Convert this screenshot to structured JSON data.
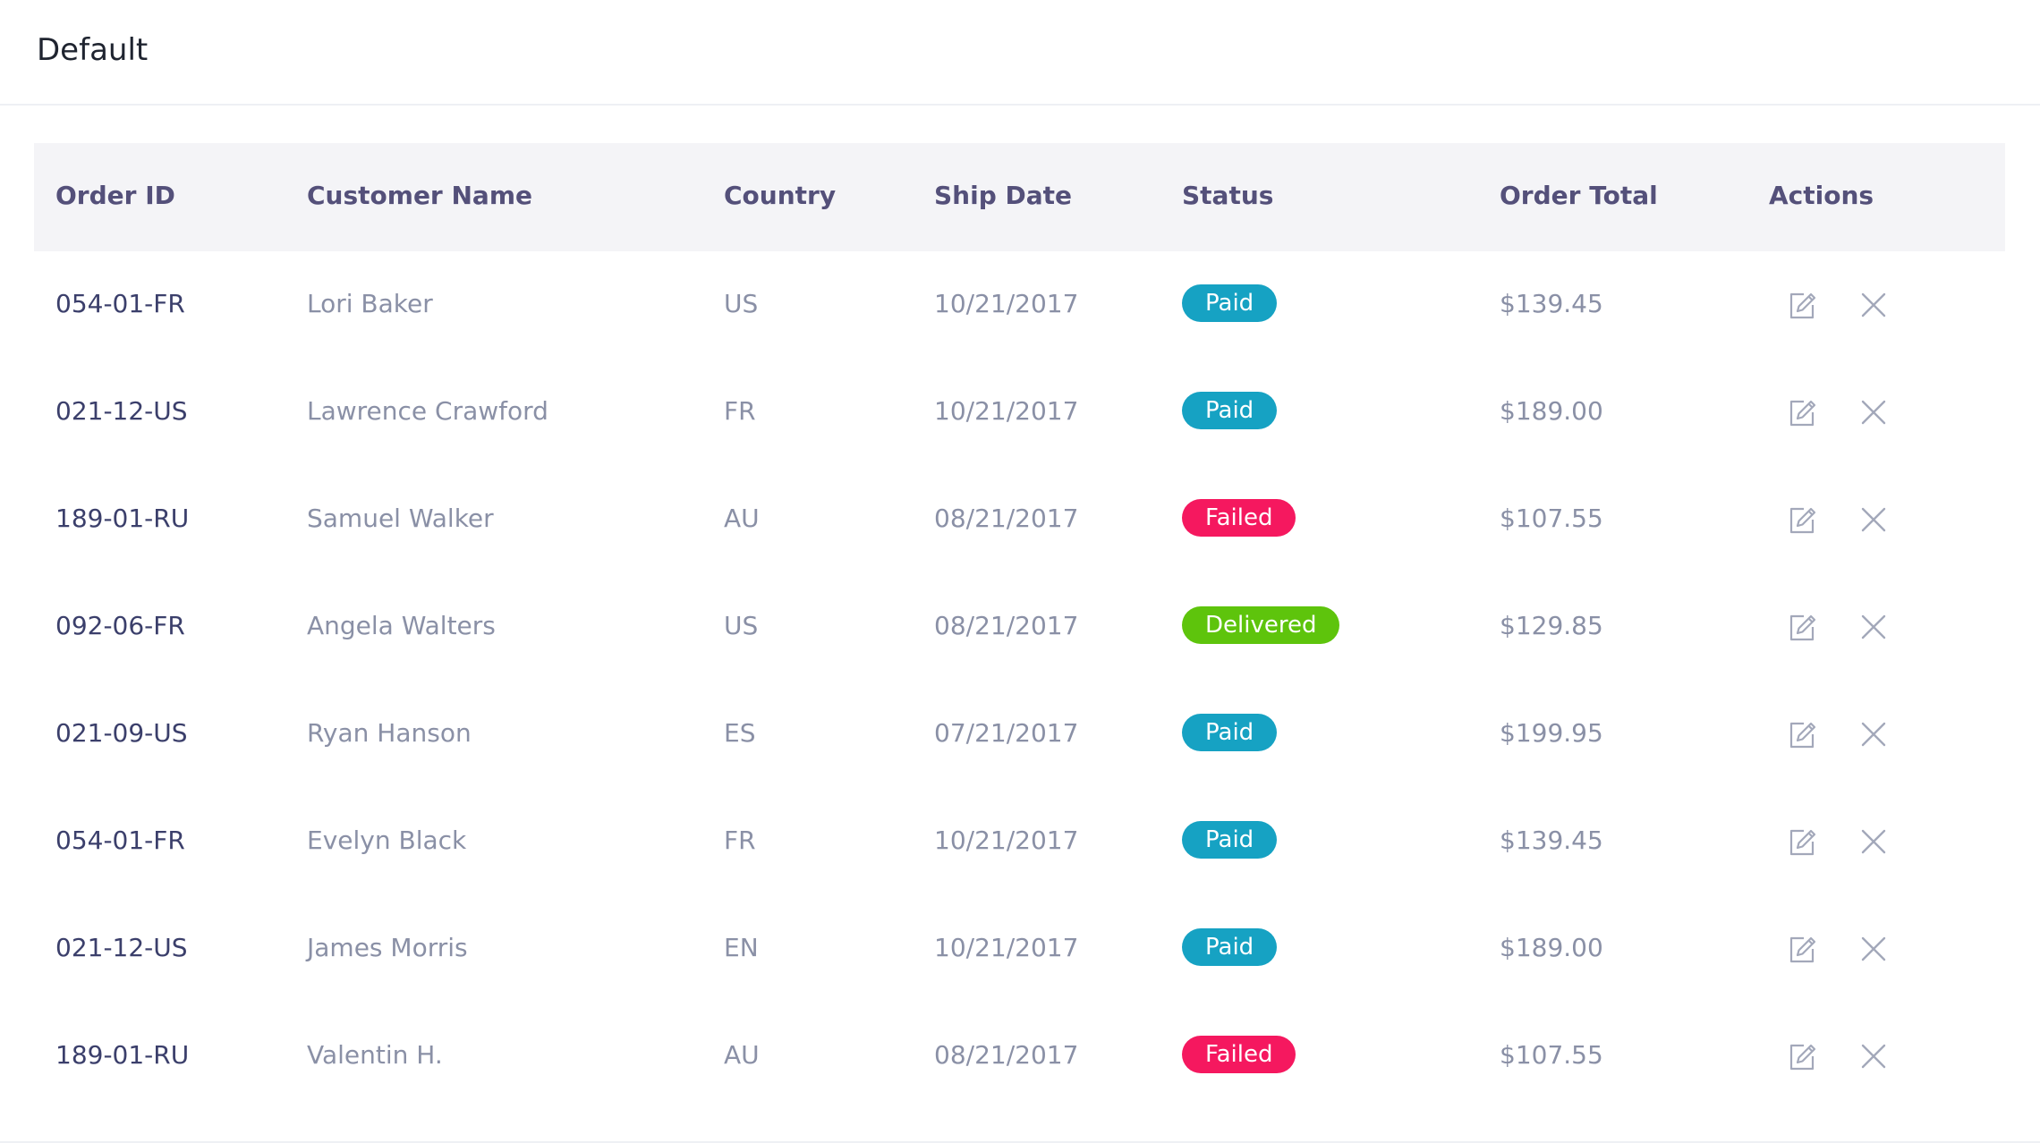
{
  "header": {
    "title": "Default"
  },
  "columns": {
    "order_id": "Order ID",
    "customer_name": "Customer Name",
    "country": "Country",
    "ship_date": "Ship Date",
    "status": "Status",
    "order_total": "Order Total",
    "actions": "Actions"
  },
  "status_colors": {
    "Paid": "#16a2c3",
    "Failed": "#f5185f",
    "Delivered": "#5ec40c"
  },
  "rows": [
    {
      "order_id": "054-01-FR",
      "customer_name": "Lori Baker",
      "country": "US",
      "ship_date": "10/21/2017",
      "status": "Paid",
      "order_total": "$139.45"
    },
    {
      "order_id": "021-12-US",
      "customer_name": "Lawrence Crawford",
      "country": "FR",
      "ship_date": "10/21/2017",
      "status": "Paid",
      "order_total": "$189.00"
    },
    {
      "order_id": "189-01-RU",
      "customer_name": "Samuel Walker",
      "country": "AU",
      "ship_date": "08/21/2017",
      "status": "Failed",
      "order_total": "$107.55"
    },
    {
      "order_id": "092-06-FR",
      "customer_name": "Angela Walters",
      "country": "US",
      "ship_date": "08/21/2017",
      "status": "Delivered",
      "order_total": "$129.85"
    },
    {
      "order_id": "021-09-US",
      "customer_name": "Ryan Hanson",
      "country": "ES",
      "ship_date": "07/21/2017",
      "status": "Paid",
      "order_total": "$199.95"
    },
    {
      "order_id": "054-01-FR",
      "customer_name": "Evelyn Black",
      "country": "FR",
      "ship_date": "10/21/2017",
      "status": "Paid",
      "order_total": "$139.45"
    },
    {
      "order_id": "021-12-US",
      "customer_name": "James Morris",
      "country": "EN",
      "ship_date": "10/21/2017",
      "status": "Paid",
      "order_total": "$189.00"
    },
    {
      "order_id": "189-01-RU",
      "customer_name": "Valentin H.",
      "country": "AU",
      "ship_date": "08/21/2017",
      "status": "Failed",
      "order_total": "$107.55"
    }
  ],
  "icons": {
    "edit": "edit-icon",
    "delete": "close-icon"
  }
}
